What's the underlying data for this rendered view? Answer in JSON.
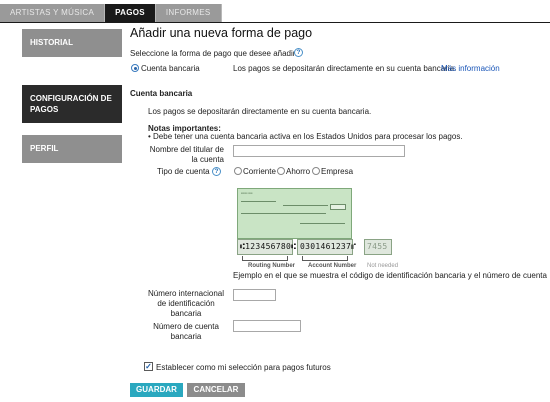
{
  "tabs": [
    {
      "label": "ARTISTAS Y MÚSICA"
    },
    {
      "label": "PAGOS"
    },
    {
      "label": "INFORMES"
    }
  ],
  "sidebar": {
    "items": [
      {
        "label": "HISTORIAL"
      },
      {
        "label_line1": "CONFIGURACIÓN DE",
        "label_line2": "PAGOS"
      },
      {
        "label": "PERFIL"
      }
    ]
  },
  "main": {
    "title": "Añadir una nueva forma de pago",
    "select_prompt": "Seleccione la forma de pago que desee añadir.",
    "help_glyph": "?",
    "payment_option": {
      "label": "Cuenta bancaria",
      "description": "Los pagos se depositarán directamente en su cuenta bancaria.",
      "more_info_link": "Más información"
    },
    "section_title": "Cuenta bancaria",
    "section_description": "Los pagos se depositarán directamente en su cuenta bancaria.",
    "notes_title": "Notas importantes:",
    "notes": [
      "Debe tener una cuenta bancaria activa en los Estados Unidos para procesar los pagos."
    ],
    "fields": {
      "holder_label_line1": "Nombre del titular de",
      "holder_label_line2": "la cuenta",
      "holder_value": "",
      "account_type_label": "Tipo de cuenta",
      "account_types": [
        "Corriente",
        "Ahorro",
        "Empresa"
      ],
      "iban_label_line1": "Número internacional",
      "iban_label_line2": "de identificación",
      "iban_label_line3": "bancaria",
      "iban_value": "",
      "account_number_label_line1": "Número de cuenta",
      "account_number_label_line2": "bancaria",
      "account_number_value": ""
    },
    "check_image": {
      "routing_digits": "⑆123456780⑆",
      "account_digits": "0301461237⑈",
      "extra_digits": "7455",
      "routing_caption": "Routing Number",
      "account_caption": "Account Number",
      "not_needed_caption": "Not needed",
      "example_text": "Ejemplo en el que se muestra el código de identificación bancaria y el número de cuenta"
    },
    "save_default_label": "Establecer como mi selección para pagos futuros",
    "save_default_checked": true,
    "buttons": {
      "save": "GUARDAR",
      "cancel": "CANCELAR"
    }
  },
  "colors": {
    "primary_button": "#2aa8bf",
    "secondary_button": "#8c8c8c",
    "active_tab": "#1a1a1a",
    "sidebar_active": "#2b2b2b",
    "sidebar_inactive": "#8f8f8f",
    "link": "#1a56b8"
  }
}
